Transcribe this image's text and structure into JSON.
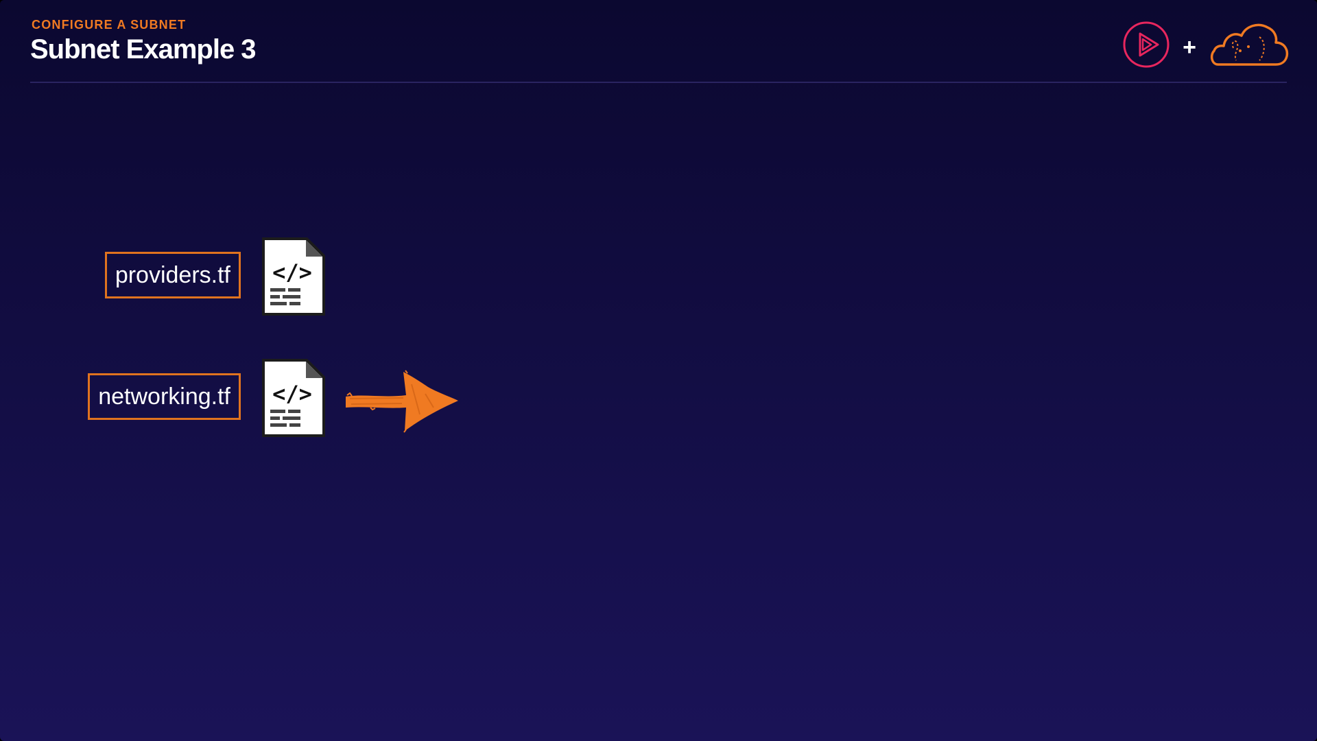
{
  "header": {
    "kicker": "CONFIGURE A SUBNET",
    "title": "Subnet Example 3"
  },
  "branding": {
    "logo_icon": "pluralsight-play-logo-icon",
    "separator": "+",
    "cloud_icon": "aws-cloud-icon",
    "accent_color": "#f07a22",
    "logo_color": "#e8265e"
  },
  "files": [
    {
      "label": "providers.tf",
      "icon": "code-file-icon"
    },
    {
      "label": "networking.tf",
      "icon": "code-file-icon"
    }
  ],
  "arrow": {
    "icon": "orange-arrow-right-icon",
    "color": "#f07a22"
  },
  "colors": {
    "background_top": "#0b0830",
    "background_bottom": "#1a1357",
    "label_border": "#e0731f"
  }
}
